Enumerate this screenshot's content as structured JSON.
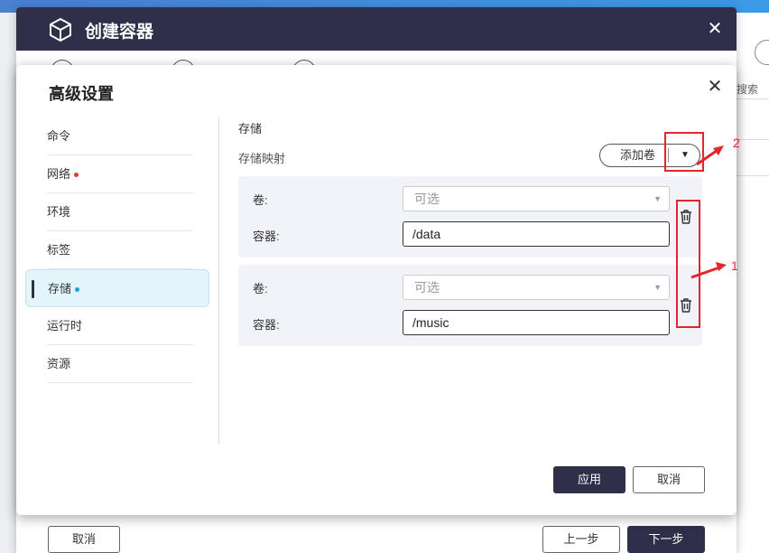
{
  "background": {
    "search_fragment": "搜索"
  },
  "main_window": {
    "title": "创建容器",
    "close_glyph": "✕",
    "cancel_label": "取消",
    "prev_label": "上一步",
    "next_label": "下一步"
  },
  "dialog": {
    "title": "高级设置",
    "close_glyph": "✕",
    "nav": [
      {
        "label": "命令"
      },
      {
        "label": "网络",
        "dot_color": "#e03a3a"
      },
      {
        "label": "环境"
      },
      {
        "label": "标签"
      },
      {
        "label": "存储",
        "dot_color": "#1e9fe0",
        "active": true
      },
      {
        "label": "运行时"
      },
      {
        "label": "资源"
      }
    ],
    "section_title": "存储",
    "section_subtitle": "存储映射",
    "add_volume_label": "添加卷",
    "add_volume_caret": "▼",
    "mappings": [
      {
        "volume_label": "卷:",
        "volume_placeholder": "可选",
        "container_label": "容器:",
        "container_value": "/data"
      },
      {
        "volume_label": "卷:",
        "volume_placeholder": "可选",
        "container_label": "容器:",
        "container_value": "/music"
      }
    ],
    "apply_label": "应用",
    "cancel_label": "取消"
  },
  "annotations": {
    "label_1": "1",
    "label_2": "2",
    "color": "#e3262b"
  },
  "colors": {
    "header_dark": "#2f2f4a",
    "active_nav_bg": "#e3f4fc",
    "mapping_bg": "#f2f3f8"
  }
}
